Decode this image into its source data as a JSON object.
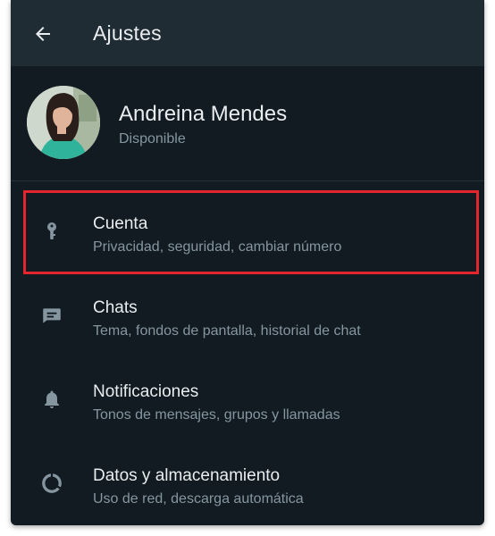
{
  "appbar": {
    "title": "Ajustes",
    "back_icon": "arrow-left-icon"
  },
  "profile": {
    "name": "Andreina Mendes",
    "status": "Disponible"
  },
  "settings": [
    {
      "title": "Cuenta",
      "subtitle": "Privacidad, seguridad, cambiar número",
      "icon": "key-icon"
    },
    {
      "title": "Chats",
      "subtitle": "Tema, fondos de pantalla, historial de chat",
      "icon": "chat-icon"
    },
    {
      "title": "Notificaciones",
      "subtitle": "Tonos de mensajes, grupos y llamadas",
      "icon": "bell-icon"
    },
    {
      "title": "Datos y almacenamiento",
      "subtitle": "Uso de red, descarga automática",
      "icon": "data-usage-icon"
    }
  ],
  "colors": {
    "background": "#111b21",
    "appbar": "#1f2c34",
    "primary_text": "#e9edef",
    "secondary_text": "#8696a0",
    "icon": "#8696a0",
    "highlight": "#e3262d"
  }
}
